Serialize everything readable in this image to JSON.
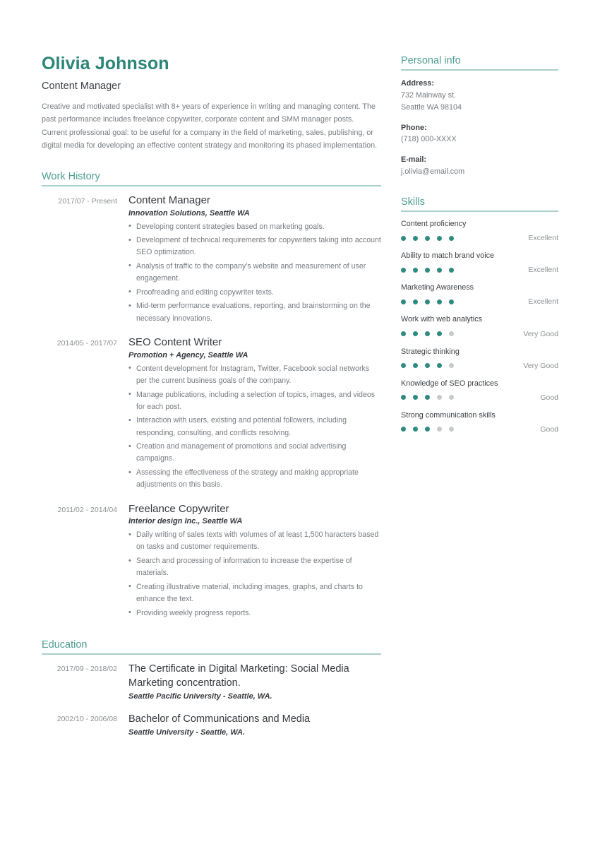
{
  "header": {
    "name": "Olivia Johnson",
    "title": "Content Manager",
    "summary": "Creative and motivated specialist with 8+ years of experience in writing and managing content. The past performance includes freelance copywriter, corporate content and SMM manager posts.  Current professional goal: to be useful for a company in the field of marketing, sales, publishing, or digital media for developing an effective content strategy and monitoring its phased implementation."
  },
  "work_history": {
    "heading": "Work History",
    "entries": [
      {
        "dates": "2017/07 - Present",
        "title": "Content Manager",
        "org": "Innovation Solutions, Seattle WA",
        "bullets": [
          "Developing content strategies based on marketing goals.",
          "Development of technical requirements for copywriters taking into account SEO optimization.",
          "Analysis of traffic to the company’s website and measurement of user engagement.",
          "Proofreading and editing copywriter texts.",
          "Mid-term performance evaluations, reporting, and brainstorming on the necessary innovations."
        ]
      },
      {
        "dates": "2014/05 - 2017/07",
        "title": "SEO Content Writer",
        "org": "Promotion + Agency, Seattle WA",
        "bullets": [
          "Content development for Instagram, Twitter, Facebook social networks per the current business goals of the company.",
          "Manage publications, including a selection of topics, images, and videos for each post.",
          "Interaction with users, existing and potential followers, including responding, consulting, and conflicts resolving.",
          "Creation and management of promotions and social advertising campaigns.",
          "Assessing the effectiveness of the strategy and making appropriate adjustments on this basis."
        ]
      },
      {
        "dates": "2011/02 - 2014/04",
        "title": "Freelance Copywriter",
        "org": "Interior design Inc., Seattle WA",
        "bullets": [
          "Daily writing of sales texts with volumes of at least 1,500 haracters based on tasks and customer requirements.",
          "Search and processing of information to increase the expertise of materials.",
          "Creating illustrative material, including images, graphs, and charts to enhance the text.",
          "Providing weekly progress reports."
        ]
      }
    ]
  },
  "education": {
    "heading": "Education",
    "entries": [
      {
        "dates": "2017/09 - 2018/02",
        "title": "The Certificate in Digital Marketing: Social Media Marketing concentration.",
        "org": "Seattle Pacific University - Seattle, WA."
      },
      {
        "dates": "2002/10 - 2006/08",
        "title": "Bachelor of Communications and Media",
        "org": "Seattle University - Seattle, WA."
      }
    ]
  },
  "personal_info": {
    "heading": "Personal info",
    "groups": [
      {
        "label": "Address:",
        "lines": [
          "732 Mainway st.",
          "Seattle WA 98104"
        ]
      },
      {
        "label": "Phone:",
        "lines": [
          "(718) 000-XXXX"
        ]
      },
      {
        "label": "E-mail:",
        "lines": [
          "j.olivia@email.com"
        ]
      }
    ]
  },
  "skills": {
    "heading": "Skills",
    "max_dots": 5,
    "items": [
      {
        "name": "Content proficiency",
        "filled": 5,
        "level": "Excellent"
      },
      {
        "name": "Ability to match brand voice",
        "filled": 5,
        "level": "Excellent"
      },
      {
        "name": "Marketing Awareness",
        "filled": 5,
        "level": "Excellent"
      },
      {
        "name": "Work with web analytics",
        "filled": 4,
        "level": "Very Good"
      },
      {
        "name": "Strategic thinking",
        "filled": 4,
        "level": "Very Good"
      },
      {
        "name": "Knowledge of SEO practices",
        "filled": 3,
        "level": "Good"
      },
      {
        "name": "Strong communication skills",
        "filled": 3,
        "level": "Good"
      }
    ]
  },
  "theme": {
    "accent": "#2b8577",
    "heading": "#4d9e92",
    "rule": "#a8cfc9",
    "dot_on": "#2e8b7f",
    "dot_off": "#c6cace"
  }
}
